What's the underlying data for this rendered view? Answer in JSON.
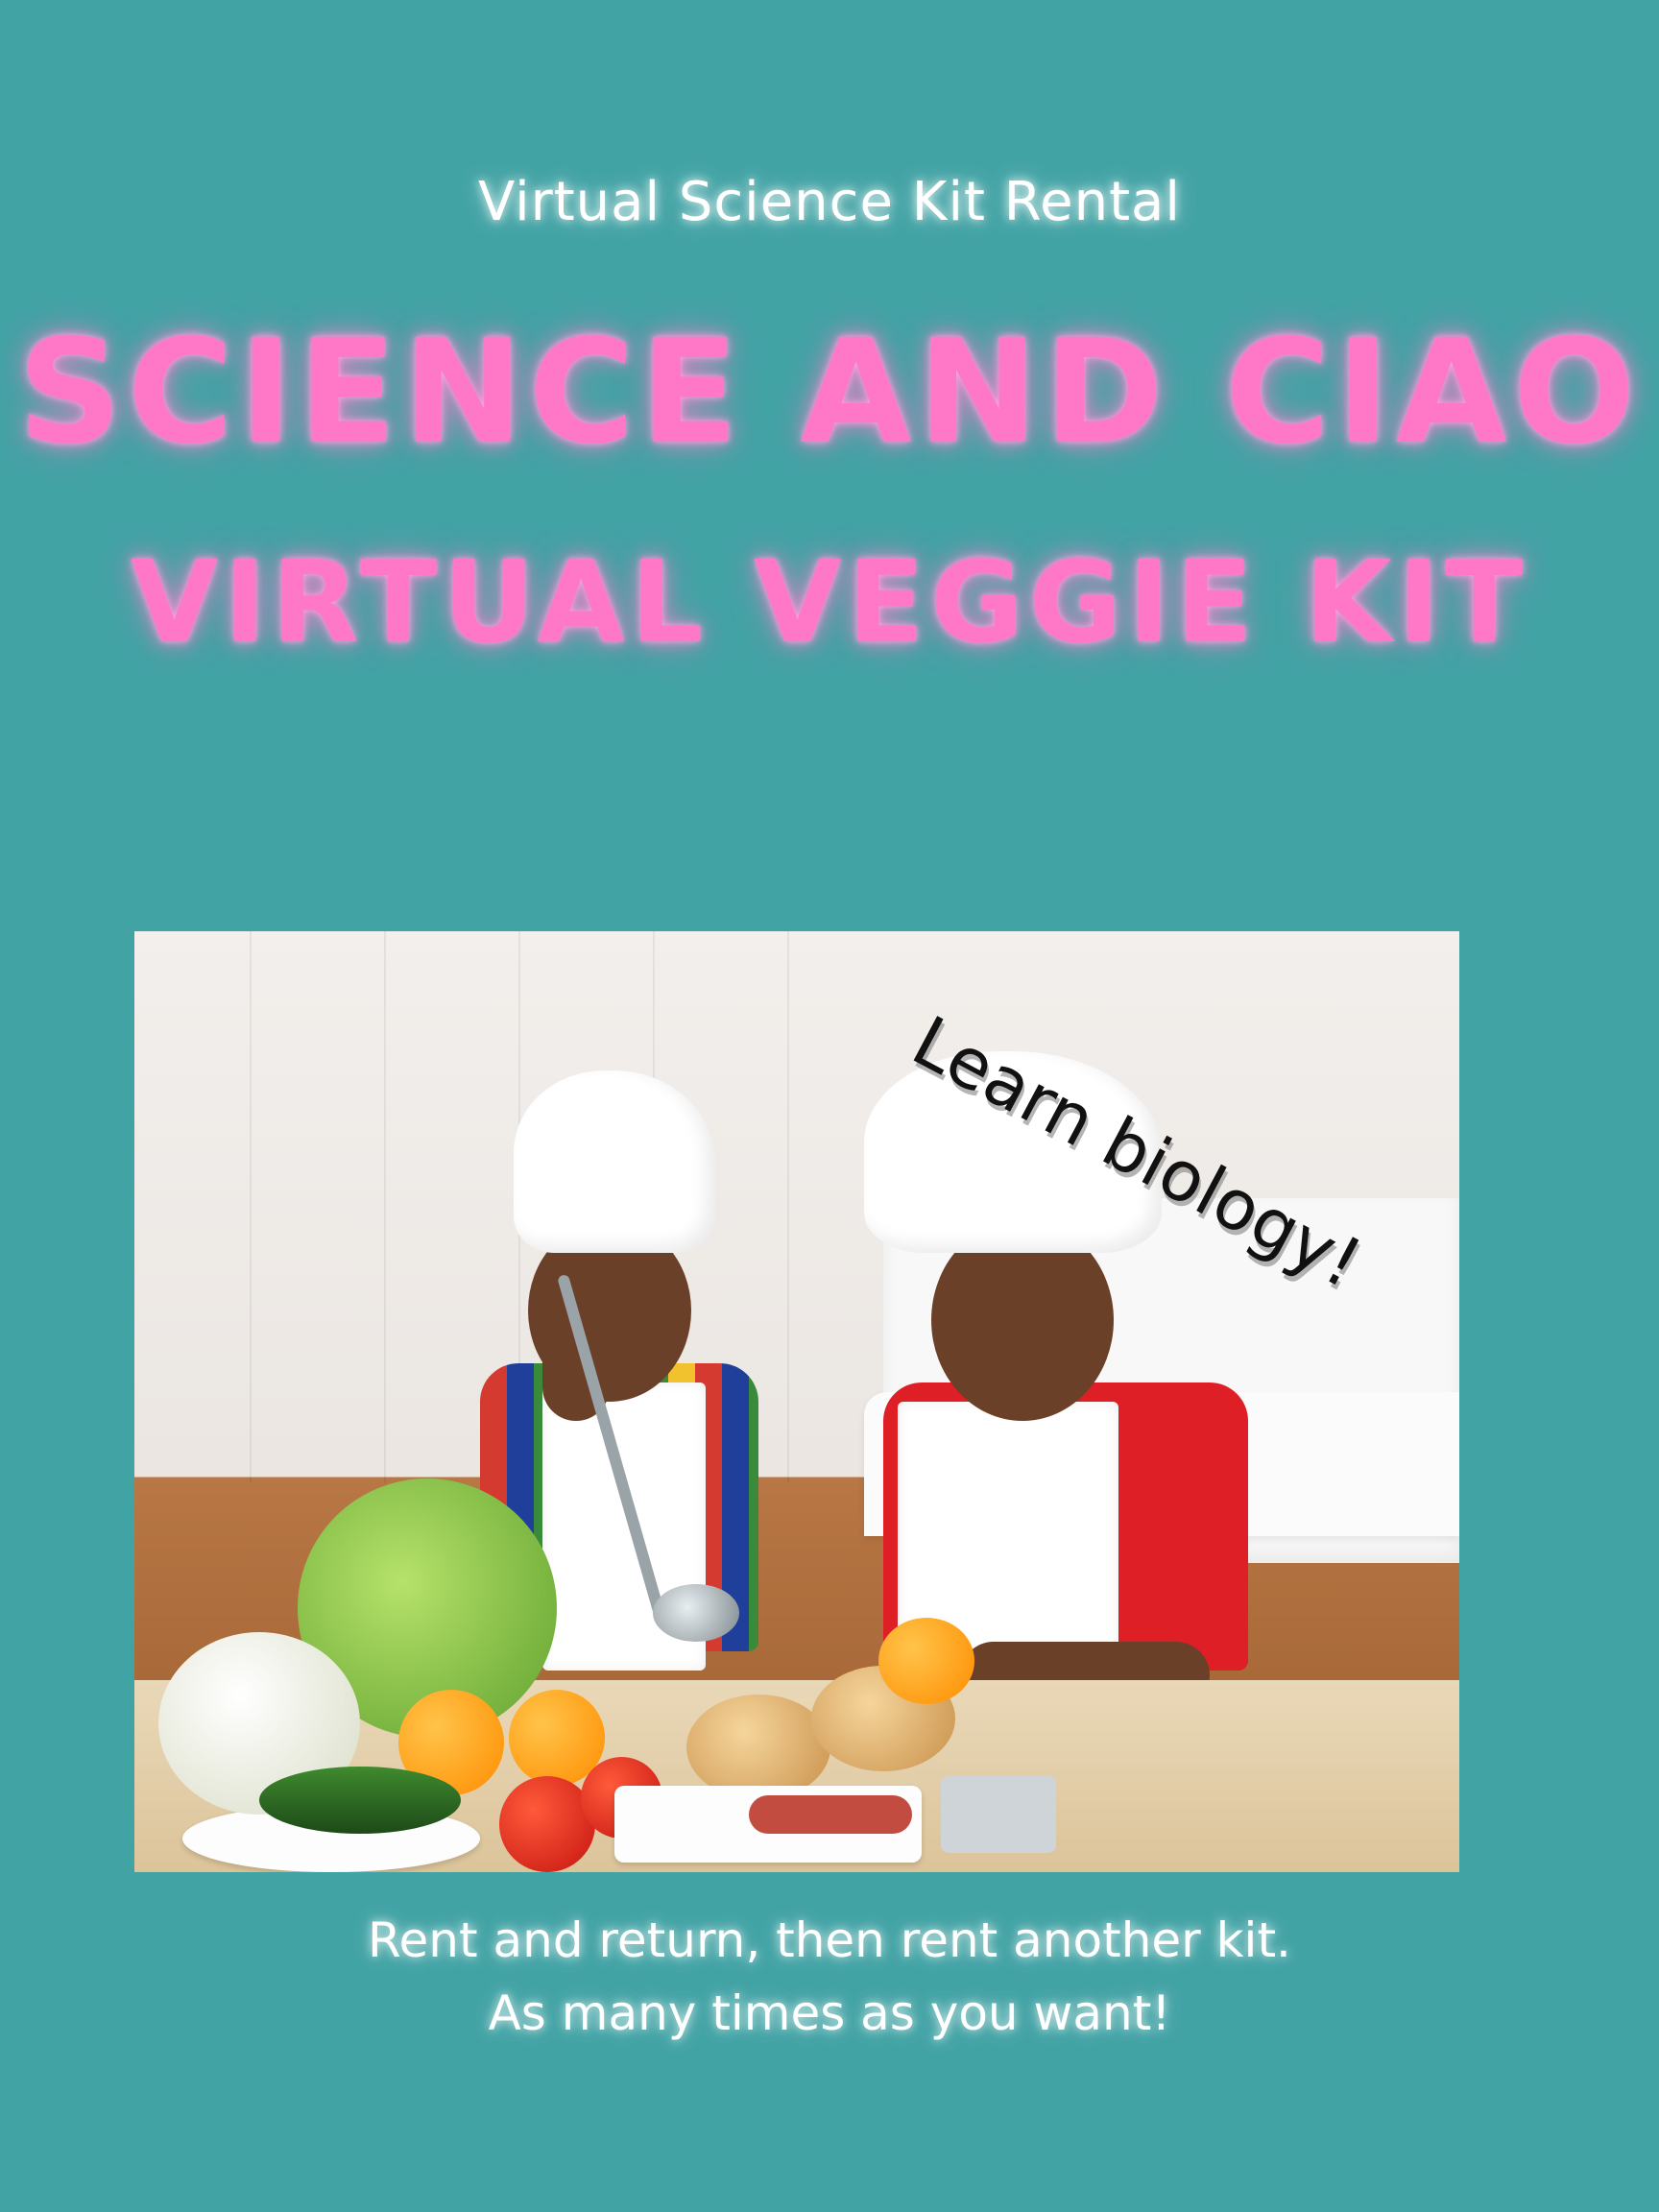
{
  "header": {
    "eyebrow": "Virtual Science Kit Rental",
    "title_line1": "SCIENCE AND CIAO",
    "title_line2": "VIRTUAL VEGGIE KIT"
  },
  "photo": {
    "caption": "Learn biology!"
  },
  "footer": {
    "line1": "Rent and return, then rent another kit.",
    "line2": "As many times as you want!"
  },
  "colors": {
    "background": "#42a3a5",
    "headline": "#ff78c8",
    "text": "#ffffff"
  }
}
